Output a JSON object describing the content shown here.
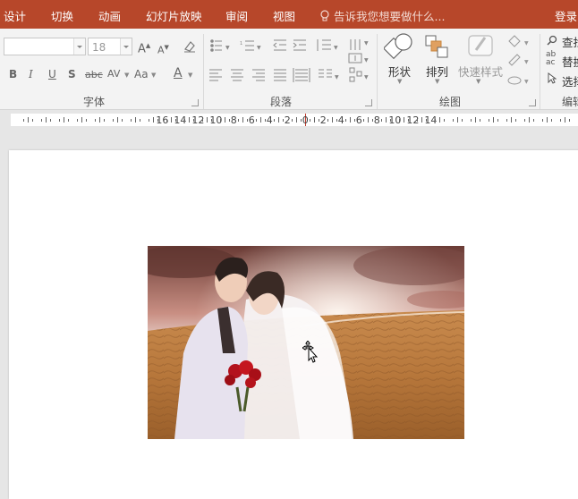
{
  "tabs": {
    "design": "设计",
    "transitions": "切换",
    "animations": "动画",
    "slideshow": "幻灯片放映",
    "review": "审阅",
    "view": "视图",
    "tell_me": "告诉我您想要做什么...",
    "login": "登录"
  },
  "ribbon": {
    "font": {
      "label": "字体",
      "font_name_value": "",
      "font_size_value": "18",
      "bold": "B",
      "italic": "I",
      "underline": "U",
      "shadow": "S",
      "strikethrough": "abc",
      "spacing": "AV",
      "case": "Aa",
      "color": "A",
      "grow": "A",
      "shrink": "A"
    },
    "paragraph": {
      "label": "段落"
    },
    "drawing": {
      "label": "绘图",
      "shapes": "形状",
      "arrange": "排列",
      "quick_styles": "快速样式"
    },
    "editing": {
      "label": "编辑",
      "find": "查找",
      "replace": "替换",
      "select": "选择"
    }
  },
  "ruler": {
    "labels": [
      "16",
      "14",
      "12",
      "10",
      "8",
      "6",
      "4",
      "2",
      "0",
      "2",
      "4",
      "6",
      "8",
      "10",
      "12",
      "14"
    ]
  },
  "colors": {
    "accent": "#b7472a",
    "ribbon_bg": "#f3f3f3"
  }
}
